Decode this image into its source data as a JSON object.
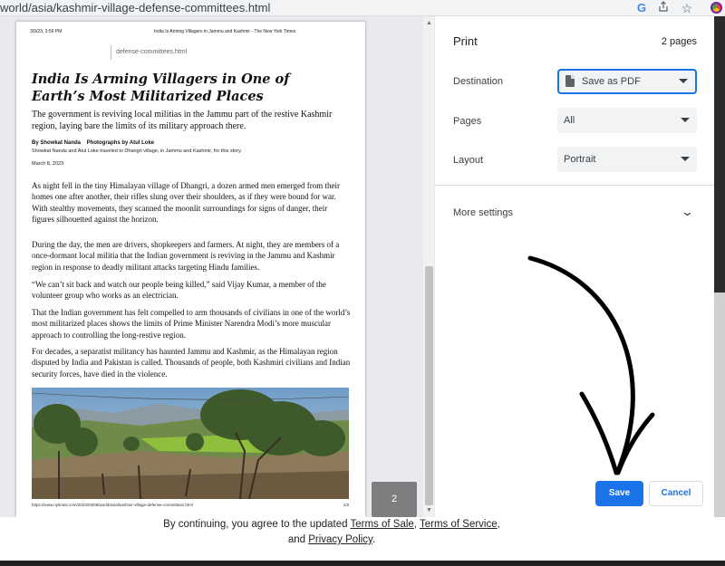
{
  "browser": {
    "url": "world/asia/kashmir-village-defense-committees.html"
  },
  "article": {
    "header_date": "3/9/23, 3:59 PM",
    "header_title": "India Is Arming Villagers in Jammu and Kashmir - The New York Times",
    "slug": "defense-committees.html",
    "headline": "India Is Arming Villagers in One of Earth’s Most Militarized Places",
    "dek": "The government is reviving local militias in the Jammu part of the restive Kashmir region, laying bare the limits of its military approach there.",
    "byline": "By Showkat Nanda    Photographs by Atul Loke",
    "byline_note": "Showkat Nanda and Atul Loke traveled to Dhangri village, in Jammu and Kashmir, for this story.",
    "date": "March 8, 2023",
    "paragraphs": [
      "As night fell in the tiny Himalayan village of Dhangri, a dozen armed men emerged from their homes one after another, their rifles slung over their shoulders, as if they were bound for war. With stealthy movements, they scanned the moonlit surroundings for signs of danger, their figures silhouetted against the horizon.",
      "During the day, the men are drivers, shopkeepers and farmers. At night, they are members of a once-dormant local militia that the Indian government is reviving in the Jammu and Kashmir region in response to deadly militant attacks targeting Hindu families.",
      "“We can’t sit back and watch our people being killed,” said Vijay Kumar, a member of the volunteer group who works as an electrician.",
      "That the Indian government has felt compelled to arm thousands of civilians in one of the world’s most militarized places shows the limits of Prime Minister Narendra Modi’s more muscular approach to controlling the long-restive region.",
      "For decades, a separatist militancy has haunted Jammu and Kashmir, as the Himalayan region disputed by India and Pakistan is called. Thousands of people, both Kashmiri civilians and Indian security forces, have died in the violence."
    ],
    "footer_url": "https://www.nytimes.com/2023/03/08/world/asia/kashmir-village-defense-committees.html",
    "footer_page": "2/2"
  },
  "preview": {
    "page_badge": "2"
  },
  "print": {
    "title": "Print",
    "page_count": "2 pages",
    "destination_label": "Destination",
    "destination_value": "Save as PDF",
    "pages_label": "Pages",
    "pages_value": "All",
    "layout_label": "Layout",
    "layout_value": "Portrait",
    "more_settings": "More settings",
    "save": "Save",
    "cancel": "Cancel"
  },
  "terms": {
    "prefix": "By continuing, you agree to the updated ",
    "sale": "Terms of Sale",
    "sep1": ", ",
    "service": "Terms of Service",
    "sep2": ",",
    "and": "and ",
    "privacy": "Privacy Policy",
    "end": "."
  },
  "colors": {
    "accent": "#1a73e8",
    "panel_bg": "#ffffff",
    "preview_bg": "#e8eaed"
  }
}
